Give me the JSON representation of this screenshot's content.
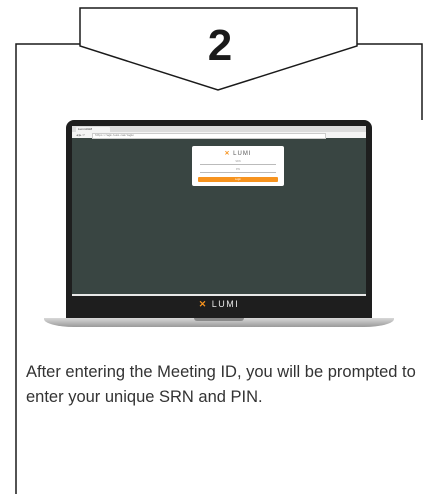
{
  "step": {
    "number": "2"
  },
  "browser": {
    "tab_title": "Lumi AGM",
    "url": "https://agm.lumi.com/login"
  },
  "login_card": {
    "logo_x": "✕",
    "logo_text": "LUMI",
    "field_srn": "SRN",
    "field_pin": "PIN",
    "button_label": "Login"
  },
  "footer": {
    "logo_x": "✕",
    "logo_text": "LUMI"
  },
  "caption": {
    "text": "After entering the Meeting ID, you will be prompted to enter your unique SRN and PIN."
  },
  "colors": {
    "accent": "#f7931e",
    "screen_bg": "#394542",
    "frame_line": "#1a1a1a"
  }
}
